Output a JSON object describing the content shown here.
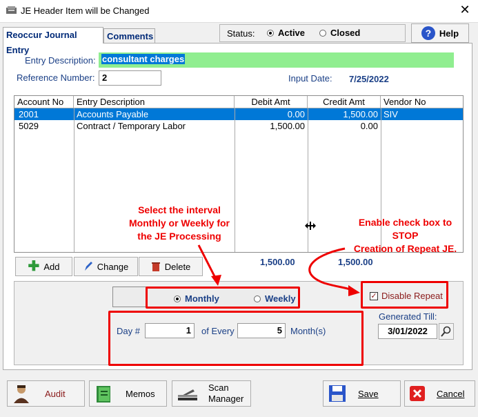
{
  "window": {
    "title": "JE Header Item will be Changed",
    "close_glyph": "✕"
  },
  "tabs": [
    {
      "label": "Reoccur Journal Entry"
    },
    {
      "label": "Comments"
    }
  ],
  "status": {
    "label": "Status:",
    "options": [
      {
        "label": "Active",
        "selected": true
      },
      {
        "label": "Closed",
        "selected": false
      }
    ]
  },
  "help": {
    "label": "Help",
    "glyph": "?"
  },
  "form": {
    "entry_description_label": "Entry Description:",
    "entry_description_value": "consultant charges",
    "reference_number_label": "Reference Number:",
    "reference_number_value": "2",
    "input_date_label": "Input Date:",
    "input_date_value": "7/25/2022"
  },
  "table": {
    "columns": [
      "Account No",
      "Entry Description",
      "Debit Amt",
      "Credit Amt",
      "Vendor No"
    ],
    "rows": [
      {
        "account": "2001",
        "description": "Accounts Payable",
        "debit": "0.00",
        "credit": "1,500.00",
        "vendor": "SIV",
        "selected": true
      },
      {
        "account": "5029",
        "description": "Contract / Temporary Labor",
        "debit": "1,500.00",
        "credit": "0.00",
        "vendor": "",
        "selected": false
      }
    ],
    "totals": {
      "debit": "1,500.00",
      "credit": "1,500.00"
    }
  },
  "row_buttons": {
    "add": "Add",
    "change": "Change",
    "delete": "Delete"
  },
  "interval": {
    "options": [
      {
        "label": "Monthly",
        "selected": true
      },
      {
        "label": "Weekly",
        "selected": false
      }
    ],
    "day_label": "Day #",
    "day_value": "1",
    "every_label": "of Every",
    "every_value": "5",
    "unit_label": "Month(s)"
  },
  "disable_repeat": {
    "label": "Disable Repeat",
    "checked": true,
    "check_glyph": "✓"
  },
  "generated_till": {
    "label": "Generated Till:",
    "value": "3/01/2022"
  },
  "annotations": {
    "interval_note": [
      "Select the interval",
      "Monthly or Weekly for",
      "the JE Processing"
    ],
    "disable_note": [
      "Enable check box to",
      "STOP",
      "Creation of Repeat JE."
    ]
  },
  "footer": {
    "audit": "Audit",
    "memos": "Memos",
    "scan_line1": "Scan",
    "scan_line2": "Manager",
    "save": "Save",
    "cancel": "Cancel"
  },
  "colors": {
    "accent": "#0078d7",
    "highlight_field": "#90ee90",
    "annotation": "#ff0000",
    "label_blue": "#1a3f86"
  }
}
